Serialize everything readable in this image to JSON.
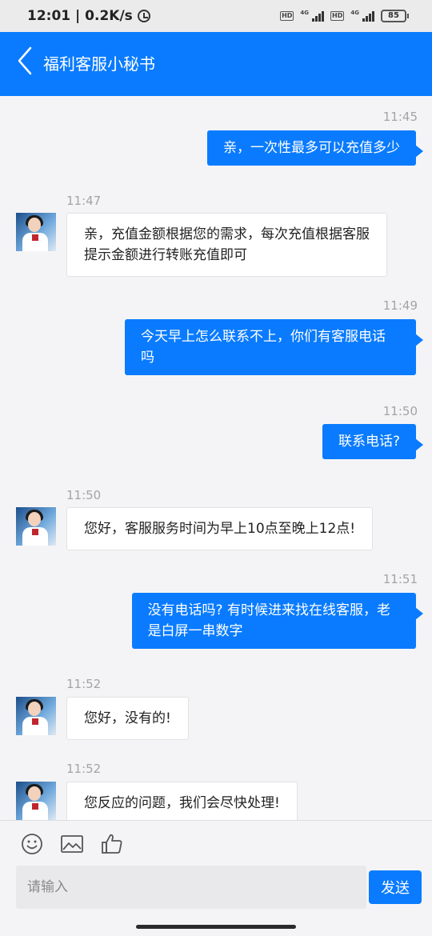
{
  "status_bar": {
    "time_speed": "12:01 | 0.2K/s",
    "hd1": "HD",
    "net1": "4G",
    "hd2": "HD",
    "net2": "4G",
    "battery": "85"
  },
  "header": {
    "title": "福利客服小秘书",
    "icon": "back-chevron-icon"
  },
  "messages": [
    {
      "time": "11:45",
      "side": "out",
      "line1": "亲，一次性最多可以充值多少",
      "line2": ""
    },
    {
      "time": "11:47",
      "side": "in",
      "line1": "亲，充值金额根据您的需求，每次充值根据客服",
      "line2": "提示金额进行转账充值即可"
    },
    {
      "time": "11:49",
      "side": "out",
      "line1": "今天早上怎么联系不上，你们有客服电话",
      "line2": "吗"
    },
    {
      "time": "11:50",
      "side": "out",
      "line1": "联系电话?",
      "line2": ""
    },
    {
      "time": "11:50",
      "side": "in",
      "line1": "您好，客服服务时间为早上10点至晚上12点!",
      "line2": ""
    },
    {
      "time": "11:51",
      "side": "out",
      "line1": "没有电话吗? 有时候进来找在线客服，老",
      "line2": "是白屏一串数字"
    },
    {
      "time": "11:52",
      "side": "in",
      "line1": "您好，没有的!",
      "line2": ""
    },
    {
      "time": "11:52",
      "side": "in",
      "line1": "您反应的问题，我们会尽快处理!",
      "line2": ""
    }
  ],
  "toolbar": {
    "icons": [
      "emoji-icon",
      "image-icon",
      "thumbs-up-icon"
    ]
  },
  "input": {
    "placeholder": "请输入",
    "value": "",
    "send_label": "发送"
  },
  "colors": {
    "accent": "#0a7bfe",
    "background": "#f4f4f6"
  }
}
